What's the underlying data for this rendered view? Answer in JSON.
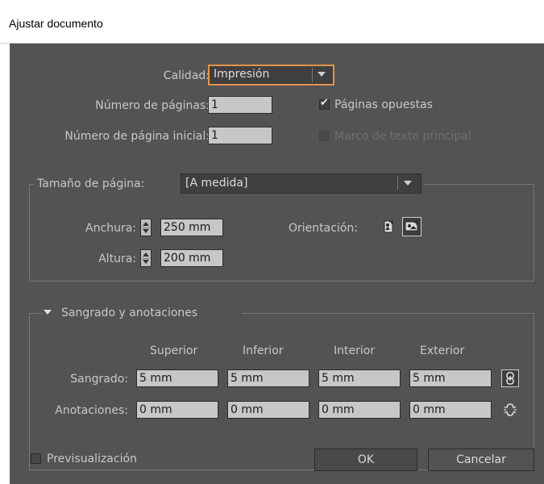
{
  "window": {
    "title": "Ajustar documento"
  },
  "quality": {
    "label": "Calidad:",
    "value": "Impresión"
  },
  "pages": {
    "count_label": "Número de páginas:",
    "count_value": "1",
    "start_label": "Número de página inicial:",
    "start_value": "1"
  },
  "options": {
    "facing_pages_label": "Páginas opuestas",
    "facing_pages_checked": true,
    "primary_text_frame_label": "Marco de texto principal",
    "primary_text_frame_enabled": false
  },
  "page_size": {
    "label": "Tamaño de página:",
    "value": "[A medida]",
    "width_label": "Anchura:",
    "width_value": "250 mm",
    "height_label": "Altura:",
    "height_value": "200 mm",
    "orientation_label": "Orientación:",
    "orientation_icons": [
      "portrait-icon",
      "landscape-icon"
    ],
    "orientation_selected": "landscape"
  },
  "bleed": {
    "section_label": "Sangrado y anotaciones",
    "columns": [
      "Superior",
      "Inferior",
      "Interior",
      "Exterior"
    ],
    "bleed_label": "Sangrado:",
    "bleed_values": [
      "5 mm",
      "5 mm",
      "5 mm",
      "5 mm"
    ],
    "slug_label": "Anotaciones:",
    "slug_values": [
      "0 mm",
      "0 mm",
      "0 mm",
      "0 mm"
    ],
    "icons": [
      "chain-linked-icon",
      "chain-broken-icon"
    ]
  },
  "footer": {
    "preview_label": "Previsualización",
    "preview_checked": false,
    "ok_label": "OK",
    "cancel_label": "Cancelar"
  },
  "colors": {
    "panel_bg": "#535353",
    "field_bg": "#c7c7c7",
    "focus_accent": "#e3934a",
    "label_text": "#c8c8c8"
  }
}
